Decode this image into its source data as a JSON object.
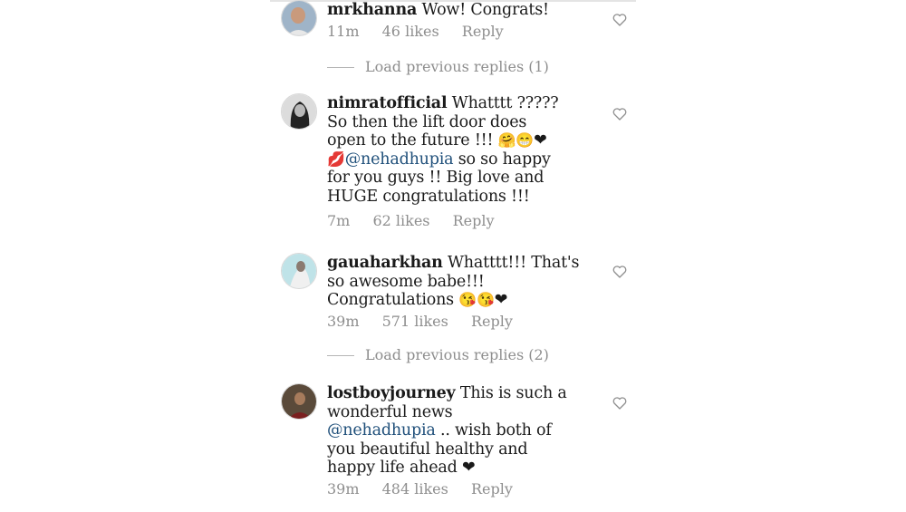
{
  "comments": [
    {
      "username": "mrkhanna",
      "text": "Wow! Congrats!",
      "time": "11m",
      "likes": "46 likes",
      "reply": "Reply"
    },
    {
      "username": "nimratofficial",
      "text_1": "Whatttt ?????",
      "text_2": "So then the lift door does",
      "text_3": "open to the future !!! ",
      "mention": "@nehadhupia",
      "text_4": " so so happy",
      "text_5": "for you guys !! Big love and",
      "text_6": "HUGE congratulations !!!",
      "time": "7m",
      "likes": "62 likes",
      "reply": "Reply"
    },
    {
      "username": "gauaharkhan",
      "text_1": "Whatttt!!! That's",
      "text_2": "so awesome babe!!!",
      "text_3": "Congratulations ",
      "time": "39m",
      "likes": "571 likes",
      "reply": "Reply"
    },
    {
      "username": "lostboyjourney",
      "text_1": "This is such a",
      "text_2": "wonderful news",
      "mention": "@nehadhupia",
      "text_3": " .. wish both of",
      "text_4": "you beautiful healthy and",
      "text_5": "happy life ahead ",
      "time": "39m",
      "likes": "484 likes",
      "reply": "Reply"
    }
  ],
  "load_replies": [
    "Load previous replies (1)",
    "Load previous replies (2)"
  ],
  "icons": {
    "like": "heart-outline-icon",
    "emoji_laugh": "🤗😁",
    "emoji_kiss": "💋",
    "emoji_love": "😘😘",
    "black_heart": "❤"
  },
  "colors": {
    "mention": "#1f4f7a",
    "meta": "#8e8e8e"
  }
}
